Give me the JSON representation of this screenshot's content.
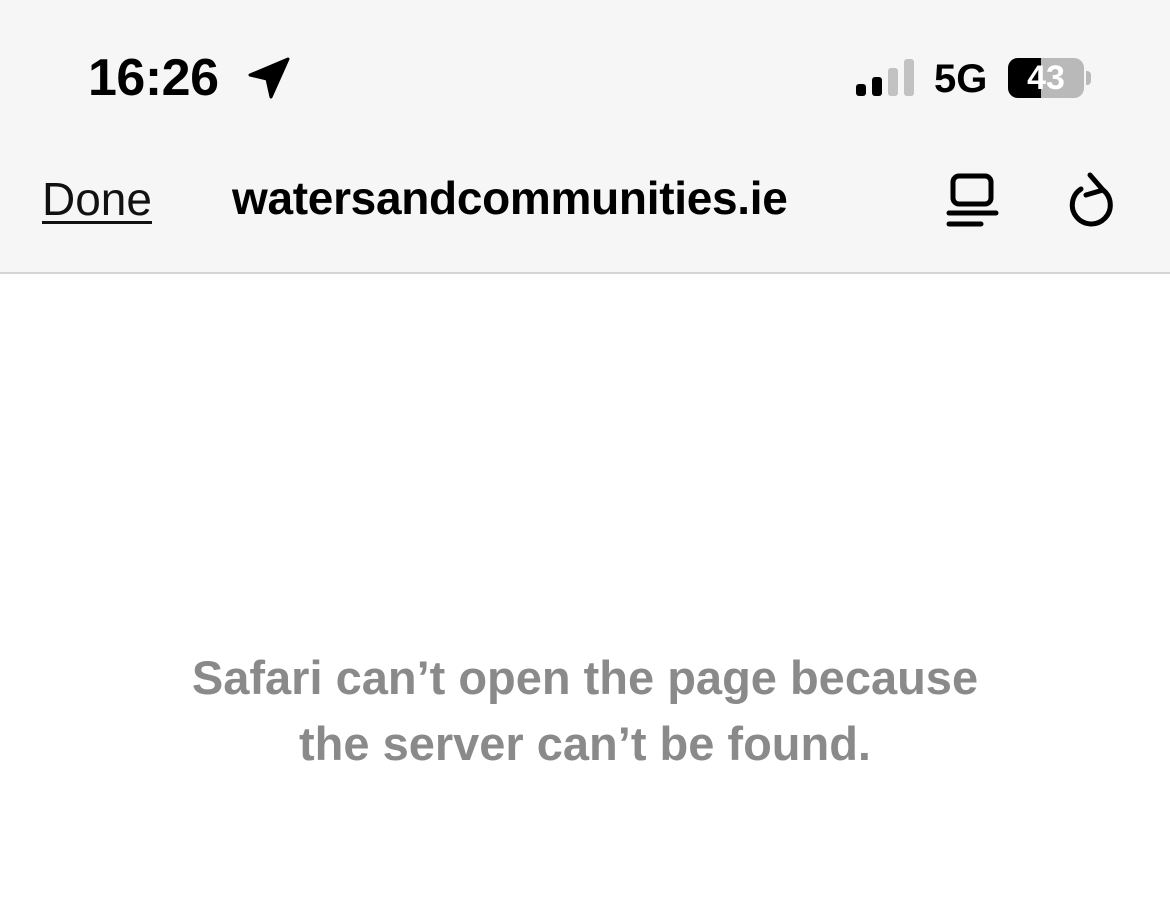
{
  "status_bar": {
    "time": "16:26",
    "network": "5G",
    "battery_level": "43",
    "battery_fraction": 0.43,
    "icons": [
      "location-arrow-icon",
      "cellular-signal-icon",
      "battery-icon"
    ]
  },
  "nav_bar": {
    "done_label": "Done",
    "url": "watersandcommunities.ie",
    "icons": [
      "reader-view-icon",
      "reload-icon"
    ]
  },
  "content": {
    "error_line1": "Safari can’t open the page because",
    "error_line2": "the server can’t be found."
  },
  "colors": {
    "chrome_background": "#f6f6f6",
    "error_text": "#8a8a8a",
    "battery_empty": "#b9b9b9"
  }
}
